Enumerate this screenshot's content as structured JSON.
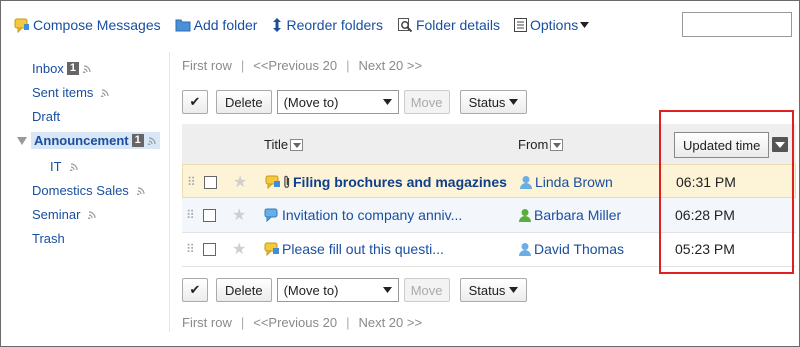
{
  "toolbar": {
    "compose": "Compose Messages",
    "add_folder": "Add folder",
    "reorder": "Reorder folders",
    "details": "Folder details",
    "options": "Options"
  },
  "sidebar": {
    "inbox": "Inbox",
    "inbox_count": "1",
    "sent": "Sent items",
    "draft": "Draft",
    "announcement": "Announcement",
    "announcement_count": "1",
    "it": "IT",
    "domestics": "Domestics Sales",
    "seminar": "Seminar",
    "trash": "Trash"
  },
  "pager": {
    "first": "First row",
    "prev": "<<Previous 20",
    "next": "Next 20 >>"
  },
  "actions": {
    "check": "✔",
    "delete": "Delete",
    "move_select": "(Move to)",
    "move": "Move",
    "status": "Status"
  },
  "columns": {
    "title": "Title",
    "from": "From",
    "updated": "Updated time"
  },
  "rows": [
    {
      "title": "Filing brochures and magazines",
      "from": "Linda Brown",
      "time": "06:31 PM"
    },
    {
      "title": "Invitation to company anniv...",
      "from": "Barbara Miller",
      "time": "06:28 PM"
    },
    {
      "title": "Please fill out this questi...",
      "from": "David Thomas",
      "time": "05:23 PM"
    }
  ],
  "colors": {
    "link": "#1a4fa0",
    "highlight_row": "#fdf3d6",
    "annotation": "#e02020"
  }
}
